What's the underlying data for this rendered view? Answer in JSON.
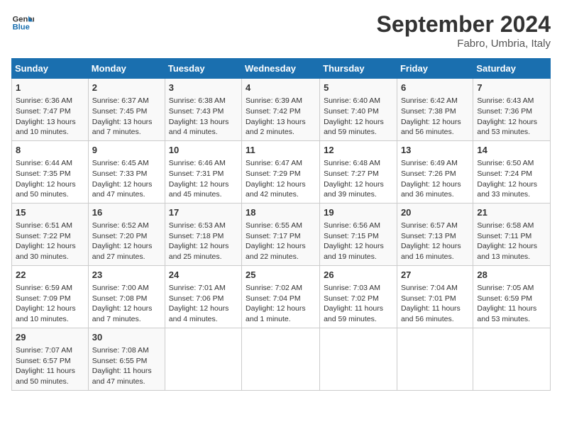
{
  "header": {
    "logo_line1": "General",
    "logo_line2": "Blue",
    "month": "September 2024",
    "location": "Fabro, Umbria, Italy"
  },
  "weekdays": [
    "Sunday",
    "Monday",
    "Tuesday",
    "Wednesday",
    "Thursday",
    "Friday",
    "Saturday"
  ],
  "weeks": [
    [
      {
        "day": "1",
        "lines": [
          "Sunrise: 6:36 AM",
          "Sunset: 7:47 PM",
          "Daylight: 13 hours",
          "and 10 minutes."
        ]
      },
      {
        "day": "2",
        "lines": [
          "Sunrise: 6:37 AM",
          "Sunset: 7:45 PM",
          "Daylight: 13 hours",
          "and 7 minutes."
        ]
      },
      {
        "day": "3",
        "lines": [
          "Sunrise: 6:38 AM",
          "Sunset: 7:43 PM",
          "Daylight: 13 hours",
          "and 4 minutes."
        ]
      },
      {
        "day": "4",
        "lines": [
          "Sunrise: 6:39 AM",
          "Sunset: 7:42 PM",
          "Daylight: 13 hours",
          "and 2 minutes."
        ]
      },
      {
        "day": "5",
        "lines": [
          "Sunrise: 6:40 AM",
          "Sunset: 7:40 PM",
          "Daylight: 12 hours",
          "and 59 minutes."
        ]
      },
      {
        "day": "6",
        "lines": [
          "Sunrise: 6:42 AM",
          "Sunset: 7:38 PM",
          "Daylight: 12 hours",
          "and 56 minutes."
        ]
      },
      {
        "day": "7",
        "lines": [
          "Sunrise: 6:43 AM",
          "Sunset: 7:36 PM",
          "Daylight: 12 hours",
          "and 53 minutes."
        ]
      }
    ],
    [
      {
        "day": "8",
        "lines": [
          "Sunrise: 6:44 AM",
          "Sunset: 7:35 PM",
          "Daylight: 12 hours",
          "and 50 minutes."
        ]
      },
      {
        "day": "9",
        "lines": [
          "Sunrise: 6:45 AM",
          "Sunset: 7:33 PM",
          "Daylight: 12 hours",
          "and 47 minutes."
        ]
      },
      {
        "day": "10",
        "lines": [
          "Sunrise: 6:46 AM",
          "Sunset: 7:31 PM",
          "Daylight: 12 hours",
          "and 45 minutes."
        ]
      },
      {
        "day": "11",
        "lines": [
          "Sunrise: 6:47 AM",
          "Sunset: 7:29 PM",
          "Daylight: 12 hours",
          "and 42 minutes."
        ]
      },
      {
        "day": "12",
        "lines": [
          "Sunrise: 6:48 AM",
          "Sunset: 7:27 PM",
          "Daylight: 12 hours",
          "and 39 minutes."
        ]
      },
      {
        "day": "13",
        "lines": [
          "Sunrise: 6:49 AM",
          "Sunset: 7:26 PM",
          "Daylight: 12 hours",
          "and 36 minutes."
        ]
      },
      {
        "day": "14",
        "lines": [
          "Sunrise: 6:50 AM",
          "Sunset: 7:24 PM",
          "Daylight: 12 hours",
          "and 33 minutes."
        ]
      }
    ],
    [
      {
        "day": "15",
        "lines": [
          "Sunrise: 6:51 AM",
          "Sunset: 7:22 PM",
          "Daylight: 12 hours",
          "and 30 minutes."
        ]
      },
      {
        "day": "16",
        "lines": [
          "Sunrise: 6:52 AM",
          "Sunset: 7:20 PM",
          "Daylight: 12 hours",
          "and 27 minutes."
        ]
      },
      {
        "day": "17",
        "lines": [
          "Sunrise: 6:53 AM",
          "Sunset: 7:18 PM",
          "Daylight: 12 hours",
          "and 25 minutes."
        ]
      },
      {
        "day": "18",
        "lines": [
          "Sunrise: 6:55 AM",
          "Sunset: 7:17 PM",
          "Daylight: 12 hours",
          "and 22 minutes."
        ]
      },
      {
        "day": "19",
        "lines": [
          "Sunrise: 6:56 AM",
          "Sunset: 7:15 PM",
          "Daylight: 12 hours",
          "and 19 minutes."
        ]
      },
      {
        "day": "20",
        "lines": [
          "Sunrise: 6:57 AM",
          "Sunset: 7:13 PM",
          "Daylight: 12 hours",
          "and 16 minutes."
        ]
      },
      {
        "day": "21",
        "lines": [
          "Sunrise: 6:58 AM",
          "Sunset: 7:11 PM",
          "Daylight: 12 hours",
          "and 13 minutes."
        ]
      }
    ],
    [
      {
        "day": "22",
        "lines": [
          "Sunrise: 6:59 AM",
          "Sunset: 7:09 PM",
          "Daylight: 12 hours",
          "and 10 minutes."
        ]
      },
      {
        "day": "23",
        "lines": [
          "Sunrise: 7:00 AM",
          "Sunset: 7:08 PM",
          "Daylight: 12 hours",
          "and 7 minutes."
        ]
      },
      {
        "day": "24",
        "lines": [
          "Sunrise: 7:01 AM",
          "Sunset: 7:06 PM",
          "Daylight: 12 hours",
          "and 4 minutes."
        ]
      },
      {
        "day": "25",
        "lines": [
          "Sunrise: 7:02 AM",
          "Sunset: 7:04 PM",
          "Daylight: 12 hours",
          "and 1 minute."
        ]
      },
      {
        "day": "26",
        "lines": [
          "Sunrise: 7:03 AM",
          "Sunset: 7:02 PM",
          "Daylight: 11 hours",
          "and 59 minutes."
        ]
      },
      {
        "day": "27",
        "lines": [
          "Sunrise: 7:04 AM",
          "Sunset: 7:01 PM",
          "Daylight: 11 hours",
          "and 56 minutes."
        ]
      },
      {
        "day": "28",
        "lines": [
          "Sunrise: 7:05 AM",
          "Sunset: 6:59 PM",
          "Daylight: 11 hours",
          "and 53 minutes."
        ]
      }
    ],
    [
      {
        "day": "29",
        "lines": [
          "Sunrise: 7:07 AM",
          "Sunset: 6:57 PM",
          "Daylight: 11 hours",
          "and 50 minutes."
        ]
      },
      {
        "day": "30",
        "lines": [
          "Sunrise: 7:08 AM",
          "Sunset: 6:55 PM",
          "Daylight: 11 hours",
          "and 47 minutes."
        ]
      },
      {
        "day": "",
        "lines": []
      },
      {
        "day": "",
        "lines": []
      },
      {
        "day": "",
        "lines": []
      },
      {
        "day": "",
        "lines": []
      },
      {
        "day": "",
        "lines": []
      }
    ]
  ]
}
